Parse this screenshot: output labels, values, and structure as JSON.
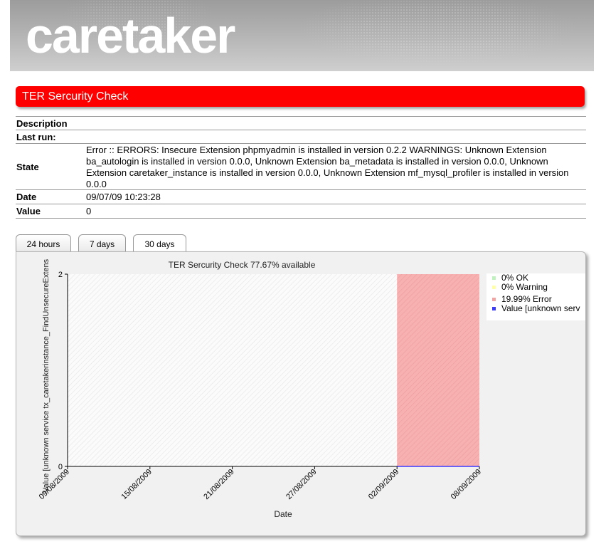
{
  "header": {
    "logo_text": "caretaker"
  },
  "title_bar": {
    "title": "TER Sercurity Check"
  },
  "details": {
    "description_label": "Description",
    "description_value": "",
    "last_run_label": "Last run:",
    "last_run_value": "",
    "state_label": "State",
    "state_value": "Error :: ERRORS: Insecure Extension phpmyadmin is installed in version 0.2.2 WARNINGS: Unknown Extension ba_autologin is installed in version 0.0.0, Unknown Extension ba_metadata is installed in version 0.0.0, Unknown Extension caretaker_instance is installed in version 0.0.0, Unknown Extension mf_mysql_profiler is installed in version 0.0.0",
    "date_label": "Date",
    "date_value": "09/07/09 10:23:28",
    "value_label": "Value",
    "value_value": "0"
  },
  "tabs": [
    {
      "label": "24 hours",
      "active": false
    },
    {
      "label": "7 days",
      "active": false
    },
    {
      "label": "30 days",
      "active": true
    }
  ],
  "chart_data": {
    "type": "area",
    "title": "TER Sercurity Check 77.67% available",
    "xlabel": "Date",
    "ylabel": "Value [unknown service tx_caretakerinstance_FindUnsecureExtens",
    "ylim": [
      0,
      2
    ],
    "yticks": [
      "0",
      "2"
    ],
    "x_ticks": [
      "09/08/2009",
      "15/08/2009",
      "21/08/2009",
      "27/08/2009",
      "02/09/2009",
      "08/09/2009"
    ],
    "xlim": [
      "09/08/2009",
      "08/09/2009"
    ],
    "error_region": {
      "from": "02/09/2009",
      "to": "08/09/2009",
      "color": "#f6a8a8"
    },
    "value_series": {
      "from": "02/09/2009",
      "to": "08/09/2009",
      "value": 0,
      "color": "#3b3bff"
    },
    "legend": [
      {
        "label": "0% OK",
        "color": "#bff2bf"
      },
      {
        "label": "0% Warning",
        "color": "#ffffa8"
      },
      {
        "label": "19.99% Error",
        "color": "#f4a3a3"
      },
      {
        "label": "Value [unknown serv",
        "color": "#3b3bff"
      }
    ],
    "legend_position": "right",
    "grid": false
  }
}
